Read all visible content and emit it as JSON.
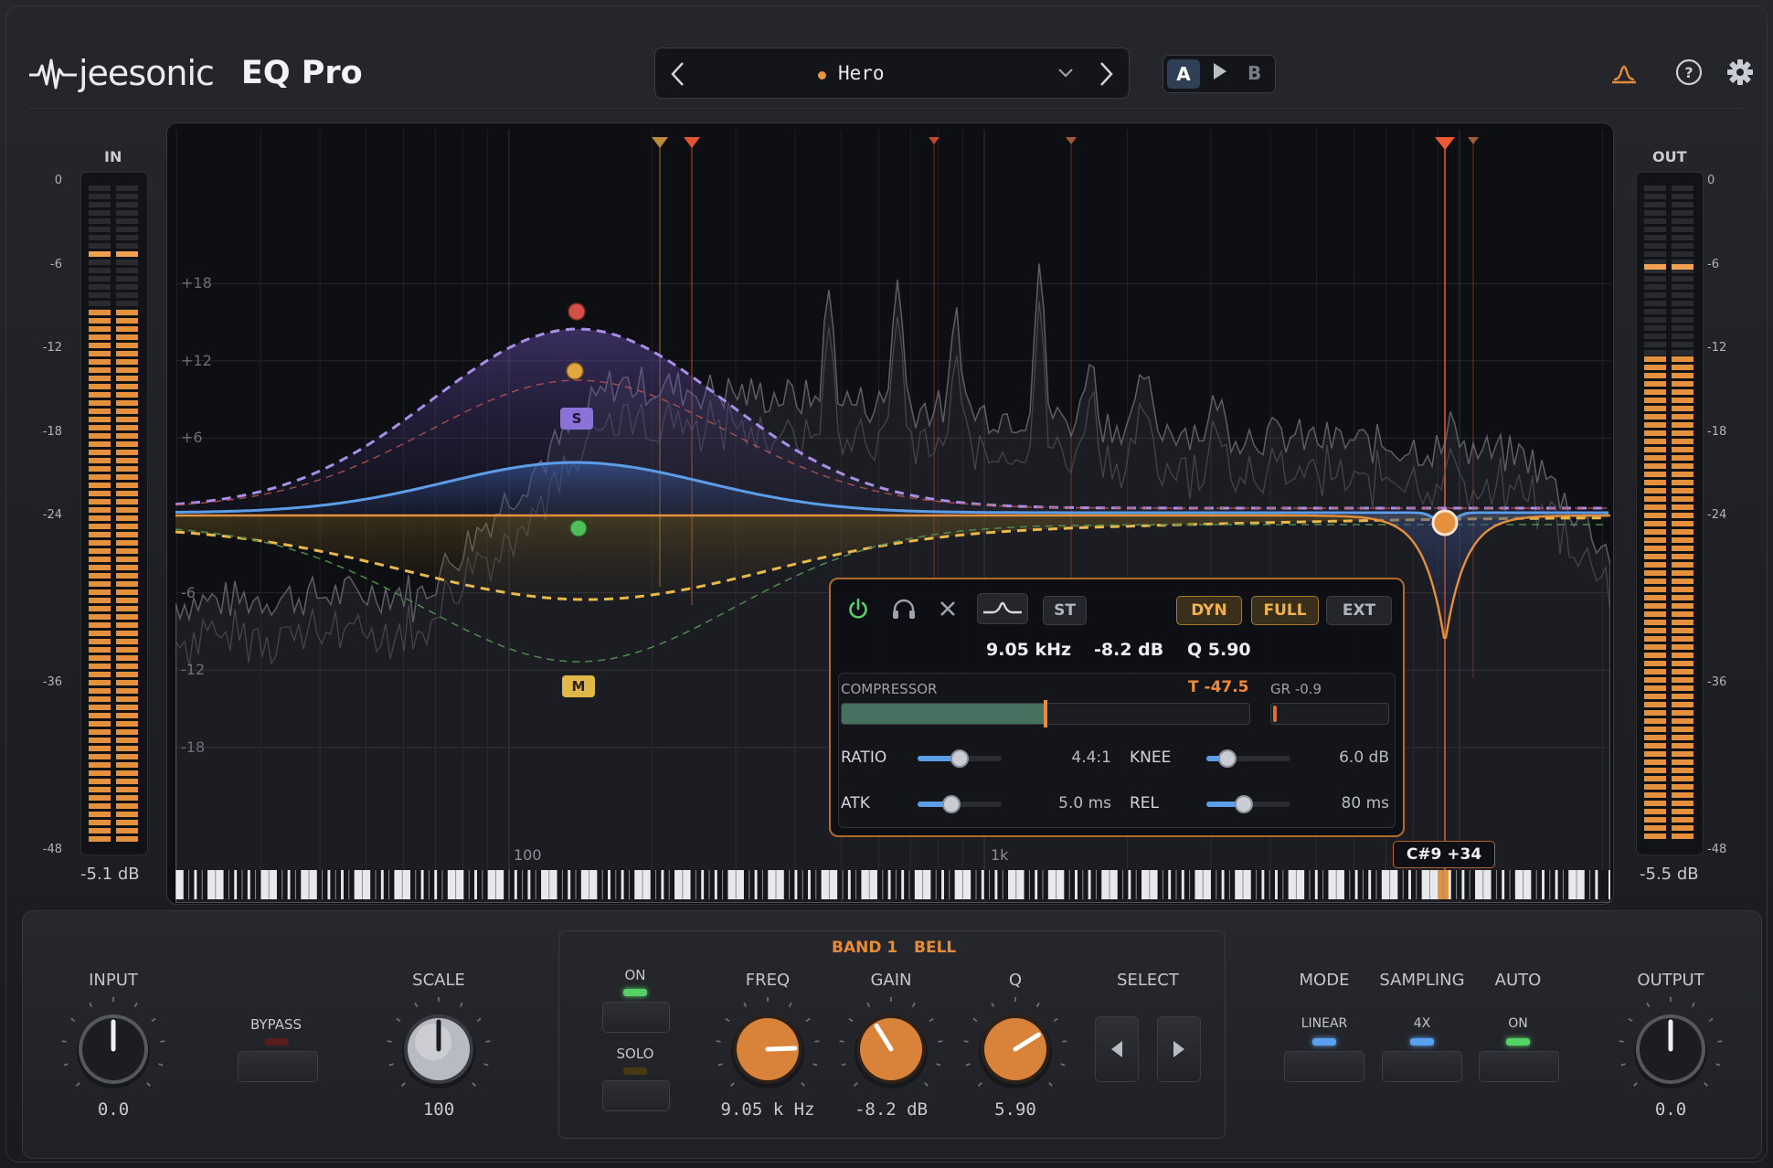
{
  "header": {
    "brand": "jeesonic",
    "product": "EQ Pro",
    "preset_name": "Hero",
    "ab": {
      "a": "A",
      "b": "B"
    }
  },
  "meters": {
    "in": {
      "title": "IN",
      "readout": "-5.1 dB",
      "levels": [
        0.81,
        0.81
      ],
      "peaks": [
        0.9,
        0.9
      ]
    },
    "out": {
      "title": "OUT",
      "readout": "-5.5 dB",
      "levels": [
        0.74,
        0.74
      ],
      "peaks": [
        0.88,
        0.88
      ]
    },
    "scale": [
      "0",
      "-6",
      "-12",
      "-18",
      "-24",
      "-36",
      "-48"
    ]
  },
  "graph": {
    "db_labels": [
      "+18",
      "+12",
      "+6",
      "-6",
      "-12",
      "-18"
    ],
    "freq_labels": [
      "100",
      "1k"
    ],
    "node_tags": {
      "s": "S",
      "m": "M"
    },
    "note_tag": "C#9 +34"
  },
  "popup": {
    "buttons": {
      "st": "ST",
      "dyn": "DYN",
      "full": "FULL",
      "ext": "EXT"
    },
    "freq": "9.05 kHz",
    "gain": "-8.2 dB",
    "q": "Q 5.90",
    "compressor": {
      "label": "COMPRESSOR",
      "threshold": "T -47.5",
      "gr": "GR -0.9",
      "level": 0.5,
      "gr_level": 0.03
    },
    "params": {
      "ratio": {
        "label": "RATIO",
        "value": "4.4:1",
        "pos": 0.5
      },
      "knee": {
        "label": "KNEE",
        "value": "6.0 dB",
        "pos": 0.25
      },
      "atk": {
        "label": "ATK",
        "value": "5.0 ms",
        "pos": 0.4
      },
      "rel": {
        "label": "REL",
        "value": "80 ms",
        "pos": 0.45
      }
    }
  },
  "controls": {
    "input": {
      "label": "INPUT",
      "value": "0.0"
    },
    "bypass": {
      "label": "BYPASS"
    },
    "scale": {
      "label": "SCALE",
      "value": "100"
    },
    "band": {
      "title": "BAND 1",
      "type": "BELL"
    },
    "on": {
      "label": "ON"
    },
    "solo": {
      "label": "SOLO"
    },
    "freq": {
      "label": "FREQ",
      "value": "9.05 k Hz"
    },
    "gain": {
      "label": "GAIN",
      "value": "-8.2 dB"
    },
    "q": {
      "label": "Q",
      "value": "5.90"
    },
    "select": {
      "label": "SELECT"
    },
    "mode": {
      "label": "MODE",
      "value": "LINEAR"
    },
    "sampling": {
      "label": "SAMPLING",
      "value": "4X"
    },
    "auto": {
      "label": "AUTO",
      "value": "ON"
    },
    "output": {
      "label": "OUTPUT",
      "value": "0.0"
    }
  },
  "colors": {
    "accent": "#e5903c",
    "blue": "#5d9de8",
    "purple": "#a98ee8",
    "yellow": "#e9b84a",
    "green_led": "#55d165"
  },
  "icons": [
    "brand-wave-icon",
    "chevron-left-icon",
    "chevron-right-icon",
    "chevron-down-icon",
    "play-icon",
    "analyzer-icon",
    "help-icon",
    "gear-icon",
    "power-icon",
    "headphones-icon",
    "close-icon",
    "bell-shape-icon"
  ]
}
